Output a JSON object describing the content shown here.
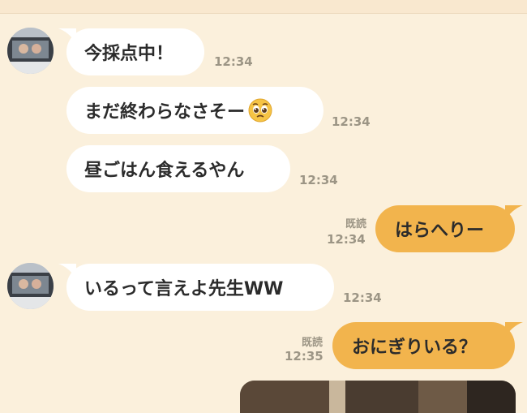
{
  "messages": [
    {
      "side": "in",
      "text": "今採点中！",
      "time": "12:34"
    },
    {
      "side": "in",
      "text": "まだ終わらなさそー",
      "emoji": "pleading-face-icon",
      "time": "12:34"
    },
    {
      "side": "in",
      "text": "昼ごはん食えるやん",
      "time": "12:34"
    },
    {
      "side": "out",
      "text": "はらへりー",
      "read": "既読",
      "time": "12:34"
    },
    {
      "side": "in",
      "text": "いるって言えよ先生WW",
      "time": "12:34"
    },
    {
      "side": "out",
      "text": "おにぎりいる？",
      "read": "既読",
      "time": "12:35"
    }
  ],
  "colors": {
    "background": "#fbf0dc",
    "incoming_bubble": "#ffffff",
    "outgoing_bubble": "#f2b44d",
    "timestamp": "#9c9585"
  }
}
